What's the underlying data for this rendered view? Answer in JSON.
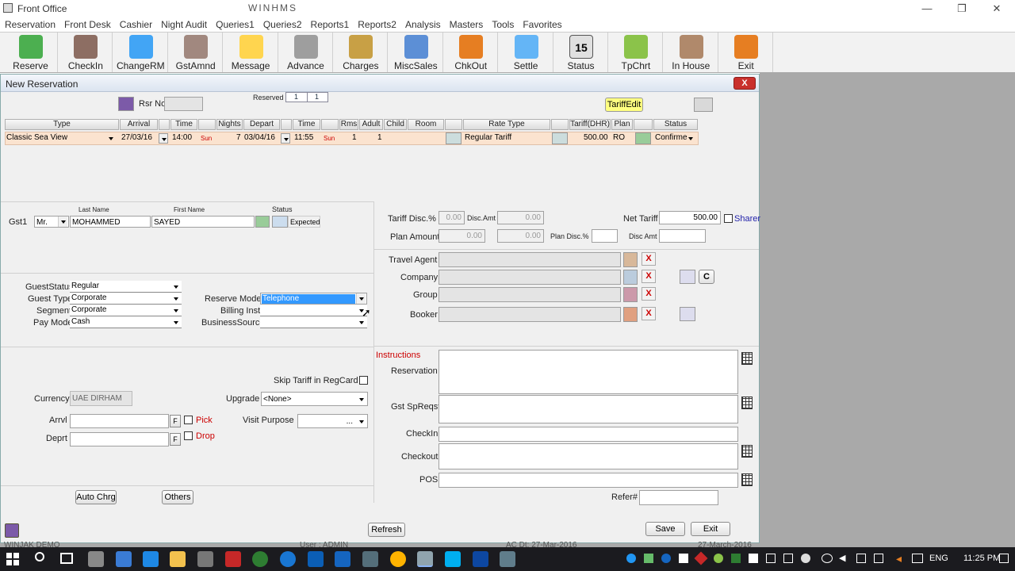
{
  "window": {
    "title": "Front Office",
    "center_title": "WINHMS"
  },
  "menu": [
    "Reservation",
    "Front Desk",
    "Cashier",
    "Night Audit",
    "Queries1",
    "Queries2",
    "Reports1",
    "Reports2",
    "Analysis",
    "Masters",
    "Tools",
    "Favorites"
  ],
  "toolbar": [
    {
      "label": "Reserve",
      "icon": "reserve-icon",
      "color": "#4caf50"
    },
    {
      "label": "CheckIn",
      "icon": "checkin-icon",
      "color": "#8d6e63"
    },
    {
      "label": "ChangeRM",
      "icon": "changerm-icon",
      "color": "#42a5f5"
    },
    {
      "label": "GstAmnd",
      "icon": "guest-amend-icon",
      "color": "#a1887f"
    },
    {
      "label": "Message",
      "icon": "message-icon",
      "color": "#ffd54f"
    },
    {
      "label": "Advance",
      "icon": "advance-icon",
      "color": "#9e9e9e"
    },
    {
      "label": "Charges",
      "icon": "charges-icon",
      "color": "#c8a045"
    },
    {
      "label": "MiscSales",
      "icon": "miscsales-icon",
      "color": "#5c8fd6"
    },
    {
      "label": "ChkOut",
      "icon": "checkout-icon",
      "color": "#e67e22"
    },
    {
      "label": "Settle",
      "icon": "settle-icon",
      "color": "#64b5f6"
    },
    {
      "label": "Status",
      "icon": "calendar-icon",
      "color": "#e0e0e0",
      "badge": "15"
    },
    {
      "label": "TpChrt",
      "icon": "chart-icon",
      "color": "#8bc34a"
    },
    {
      "label": "In House",
      "icon": "inhouse-icon",
      "color": "#b0896b"
    },
    {
      "label": "Exit",
      "icon": "exit-icon",
      "color": "#e67e22"
    }
  ],
  "form": {
    "title": "New Reservation",
    "close": "X",
    "rsr_no_label": "Rsr No",
    "reserved_label": "Reserved",
    "reserved_1": "1",
    "reserved_2": "1",
    "tariff_edit": "TariffEdit",
    "grid": {
      "headers": [
        "Type",
        "Arrival",
        "Time",
        "Nights",
        "Depart",
        "Time",
        "Rms",
        "Adult",
        "Child",
        "Room",
        "Rate Type",
        "Tariff(DHR)",
        "Plan",
        "Status"
      ],
      "row": {
        "type": "Classic Sea View",
        "arrival": "27/03/16",
        "arr_time": "14:00",
        "arr_day": "Sun",
        "nights": "7",
        "depart": "03/04/16",
        "dep_time": "11:55",
        "dep_day": "Sun",
        "rms": "1",
        "adult": "1",
        "child": "",
        "room": "",
        "rate_type": "Regular Tariff",
        "tariff": "500.00",
        "plan": "RO",
        "status": "Confirme"
      }
    },
    "guest": {
      "last_name_label": "Last Name",
      "first_name_label": "First Name",
      "status_label": "Status",
      "row_label": "Gst1",
      "title": "Mr.",
      "last_name": "MOHAMMED",
      "first_name": "SAYED",
      "status": "Expected"
    },
    "tariff": {
      "disc_pct_label": "Tariff Disc.%",
      "disc_pct": "0.00",
      "disc_amt_label": "Disc.Amt",
      "disc_amt": "0.00",
      "net_label": "Net Tariff",
      "net": "500.00",
      "sharer_label": "Sharer",
      "plan_amount_label": "Plan Amount",
      "plan_amount": "0.00",
      "plan_amount2": "0.00",
      "plan_disc_label": "Plan Disc.%",
      "plan_disc_amt_label": "Disc Amt"
    },
    "parties": {
      "travel_agent": "Travel Agent",
      "company": "Company",
      "group": "Group",
      "booker": "Booker",
      "c_button": "C"
    },
    "guest_info": {
      "guest_status_label": "GuestStatus",
      "guest_status": "Regular",
      "guest_type_label": "Guest Type",
      "guest_type": "Corporate",
      "segment_label": "Segment",
      "segment": "Corporate",
      "pay_mode_label": "Pay Mode",
      "pay_mode": "Cash",
      "reserve_mode_label": "Reserve Mode",
      "reserve_mode": "Telephone",
      "billing_inst_label": "Billing Inst",
      "business_source_label": "BusinessSource"
    },
    "misc": {
      "skip_tariff_label": "Skip Tariff in RegCard",
      "currency_label": "Currency",
      "currency": "UAE DIRHAM",
      "upgrade_label": "Upgrade",
      "upgrade": "<None>",
      "arrvl_label": "Arrvl",
      "deprt_label": "Deprt",
      "f": "F",
      "pick_label": "Pick",
      "drop_label": "Drop",
      "visit_purpose_label": "Visit Purpose",
      "visit_purpose": "...",
      "auto_chrg": "Auto Chrg",
      "others": "Others"
    },
    "instructions": {
      "title": "Instructions",
      "reservation": "Reservation",
      "gst_spreqst": "Gst SpReqst",
      "checkin": "CheckIn",
      "checkout": "Checkout",
      "pos": "POS",
      "refer_label": "Refer#"
    },
    "footer": {
      "refresh": "Refresh",
      "save": "Save",
      "exit": "Exit"
    }
  },
  "status_strip": {
    "left": "WINJAK DEMO",
    "user": "User :  ADMIN",
    "ac_dt": "AC Dt: 27-Mar-2016",
    "date": "27-March-2016"
  },
  "taskbar": {
    "lang": "ENG",
    "time": "11:25 PM"
  }
}
